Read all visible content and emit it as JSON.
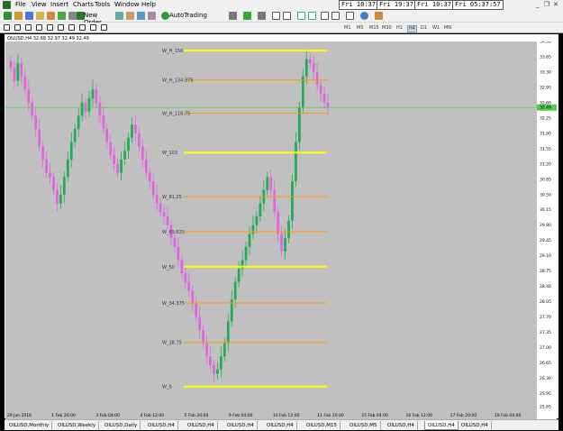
{
  "menu": {
    "items": [
      "File",
      "View",
      "Insert",
      "Charts",
      "Tools",
      "Window",
      "Help"
    ]
  },
  "clocks": [
    {
      "day": "Fri",
      "time": "10:37:57"
    },
    {
      "day": "Fri",
      "time": "19:37:57"
    },
    {
      "day": "Fri",
      "time": "10:37:57"
    },
    {
      "day": "Fri",
      "time": "05:37:57"
    }
  ],
  "toolbar": {
    "new_order_label": "New Order",
    "autotrading_label": "AutoTrading",
    "timeframes": [
      "M1",
      "M5",
      "M15",
      "M30",
      "H1",
      "H4",
      "D1",
      "W1",
      "MN"
    ],
    "active_timeframe": "H4"
  },
  "chart": {
    "title": "OILUSD,H4  32.68 32.97 32.49 32.49",
    "current_price": "32.49",
    "bull_color": "#22aa55",
    "bear_color": "#dd66dd",
    "background": "#c0c0c0"
  },
  "chart_data": {
    "type": "candlestick",
    "symbol": "OILUSD",
    "timeframe": "H4",
    "ylim": [
      25.65,
      34.0
    ],
    "y_ticks": [
      "34.00",
      "33.65",
      "33.30",
      "32.95",
      "32.60",
      "32.25",
      "31.90",
      "31.55",
      "31.20",
      "30.85",
      "30.50",
      "30.15",
      "29.80",
      "29.45",
      "29.10",
      "28.75",
      "28.40",
      "28.05",
      "27.70",
      "27.35",
      "27.00",
      "26.65",
      "26.30",
      "25.95",
      "25.65"
    ],
    "x_ticks": [
      "29 Jan 2016",
      "1 Feb 20:00",
      "3 Feb 04:00",
      "4 Feb 12:00",
      "5 Feb 20:00",
      "9 Feb 04:00",
      "10 Feb 12:00",
      "11 Feb 20:00",
      "15 Feb 04:00",
      "16 Feb 12:00",
      "17 Feb 20:00",
      "19 Feb 04:00"
    ],
    "current_price": 32.49,
    "levels": [
      {
        "label": "W_H_150",
        "price": 33.79,
        "color": "#ffff00",
        "thick": true
      },
      {
        "label": "W_H_134.375",
        "price": 33.12,
        "color": "#ff9900",
        "thick": false
      },
      {
        "label": "W_H_118.75",
        "price": 32.36,
        "color": "#ff9900",
        "thick": false
      },
      {
        "label": "W_103",
        "price": 31.46,
        "color": "#ffff00",
        "thick": true
      },
      {
        "label": "W_81.25",
        "price": 30.45,
        "color": "#ff9900",
        "thick": false
      },
      {
        "label": "W_65.625",
        "price": 29.65,
        "color": "#ff9900",
        "thick": false
      },
      {
        "label": "W_50",
        "price": 28.85,
        "color": "#ffff00",
        "thick": true
      },
      {
        "label": "W_34.375",
        "price": 28.02,
        "color": "#ff9900",
        "thick": false
      },
      {
        "label": "W_18.75",
        "price": 27.12,
        "color": "#ff9900",
        "thick": false
      },
      {
        "label": "W_0",
        "price": 26.11,
        "color": "#ffff00",
        "thick": true
      }
    ],
    "closes": [
      33.4,
      33.1,
      33.5,
      33.2,
      32.9,
      32.6,
      32.3,
      32.0,
      31.6,
      31.3,
      31.0,
      30.9,
      30.6,
      30.3,
      30.5,
      30.9,
      31.3,
      31.7,
      32.0,
      32.3,
      32.6,
      32.4,
      32.7,
      32.9,
      32.6,
      32.3,
      32.0,
      31.7,
      31.4,
      31.2,
      31.0,
      31.3,
      31.5,
      31.8,
      32.1,
      31.9,
      31.6,
      31.3,
      31.0,
      30.8,
      30.5,
      30.3,
      30.1,
      30.0,
      29.8,
      29.5,
      29.3,
      29.0,
      28.7,
      28.5,
      28.3,
      28.0,
      27.7,
      27.4,
      27.1,
      26.8,
      26.6,
      26.4,
      26.5,
      26.8,
      27.1,
      27.6,
      28.1,
      28.5,
      28.8,
      29.0,
      29.3,
      29.6,
      29.8,
      30.0,
      30.3,
      30.6,
      30.9,
      30.6,
      30.1,
      29.6,
      29.2,
      29.5,
      29.9,
      30.8,
      31.7,
      32.5,
      33.2,
      33.6,
      33.5,
      33.3,
      33.0,
      32.8,
      32.6,
      32.5
    ]
  },
  "tabs": [
    "OILUSD,Monthly",
    "OILUSD,Weekly",
    "OILUSD,Daily",
    "OILUSD,H4",
    "OILUSD,H4",
    "OILUSD,H4",
    "OILUSD,H4",
    "OILUSD,M15",
    "OILUSD,M5",
    "OILUSD,H4",
    "OILUSD,H4",
    "OILUSD,H4"
  ],
  "active_tab_index": 10
}
